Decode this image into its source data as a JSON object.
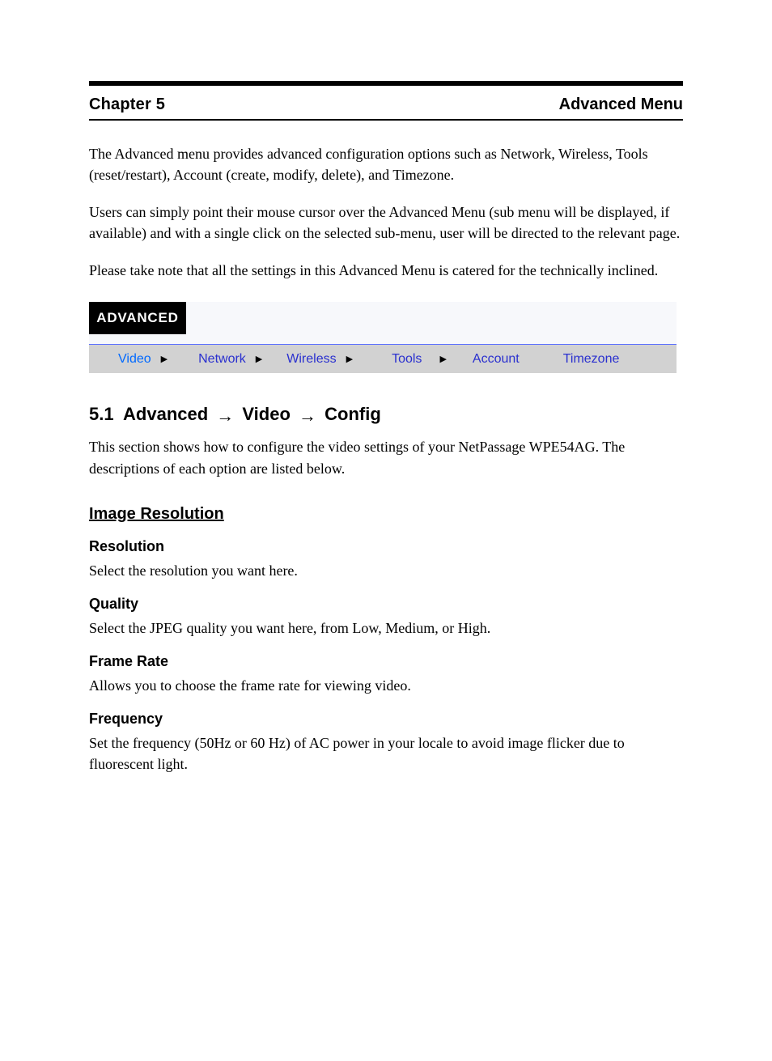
{
  "chapter": {
    "label": "Chapter 5",
    "title": "Advanced Menu"
  },
  "intro": {
    "p1": "The Advanced menu provides advanced configuration options such as Network, Wireless, Tools (reset/restart), Account (create, modify, delete), and Timezone.",
    "p2": "Users can simply point their mouse cursor over the Advanced Menu (sub menu will be displayed, if available) and with a single click on the selected sub-menu, user will be directed to the relevant page.",
    "p3": "Please take note that all the settings in this Advanced Menu is catered for the technically inclined."
  },
  "menu": {
    "tab": "ADVANCED",
    "items": [
      {
        "label": "Video",
        "has_sub": true,
        "selected": true
      },
      {
        "label": "Network",
        "has_sub": true,
        "selected": false
      },
      {
        "label": "Wireless",
        "has_sub": true,
        "selected": false
      },
      {
        "label": "Tools",
        "has_sub": true,
        "selected": false
      },
      {
        "label": "Account",
        "has_sub": false,
        "selected": false
      },
      {
        "label": "Timezone",
        "has_sub": false,
        "selected": false
      }
    ]
  },
  "sec": {
    "section_num": "5.1",
    "heading_prefix": "Advanced ",
    "heading_arrow_then": " Video ",
    "heading_tail": " Config",
    "desc": "This section shows how to configure the video settings of your NetPassage WPE54AG. The descriptions of each option are listed below.",
    "sub_image": "Image Resolution",
    "fields": {
      "resolution": {
        "title": "Resolution",
        "desc": "Select the resolution you want here."
      },
      "quality": {
        "title": "Quality",
        "desc": "Select the JPEG quality you want here, from Low, Medium, or High."
      },
      "frame_rate": {
        "title": "Frame Rate",
        "desc": "Allows you to choose the frame rate for viewing video."
      },
      "frequency": {
        "title": "Frequency",
        "desc": "Set the frequency (50Hz or 60 Hz) of AC power in your locale to avoid image flicker due to fluorescent light."
      }
    }
  }
}
